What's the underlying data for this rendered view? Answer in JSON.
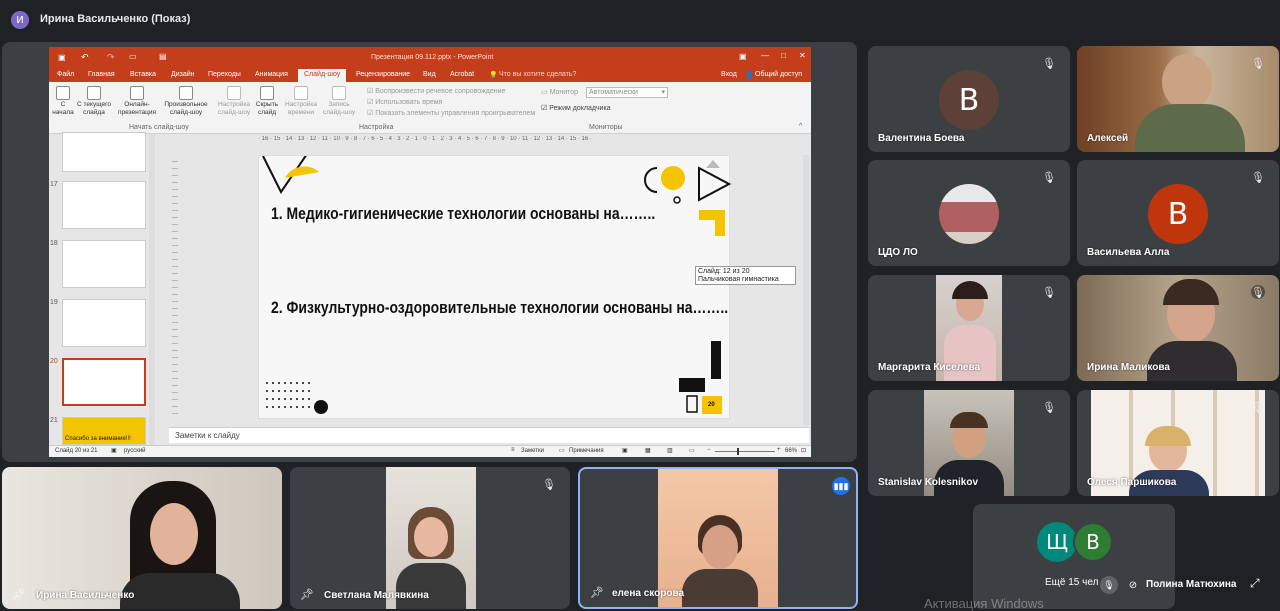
{
  "meeting": {
    "presenter_label": "Ирина Васильченко (Показ)",
    "presenter_avatar_letter": "И",
    "more_people": "Ещё 15 чел",
    "watermark": "Активация Windows"
  },
  "ppt": {
    "window_title": "Презентация 09.112.pptx - PowerPoint",
    "tabs": [
      "Файл",
      "Главная",
      "Вставка",
      "Дизайн",
      "Переходы",
      "Анимация",
      "Слайд-шоу",
      "Рецензирование",
      "Вид",
      "Acrobat"
    ],
    "tell_me": "Что вы хотите сделать?",
    "signin": "Вход",
    "share": "Общий доступ",
    "ribbon_buttons": [
      {
        "label1": "С",
        "label2": "начала"
      },
      {
        "label1": "С текущего",
        "label2": "слайда"
      },
      {
        "label1": "Онлайн-",
        "label2": "презентация"
      },
      {
        "label1": "Произвольное",
        "label2": "слайд-шоу"
      },
      {
        "label1": "Настройка",
        "label2": "слайд-шоу"
      },
      {
        "label1": "Скрыть",
        "label2": "слайд"
      },
      {
        "label1": "Настройка",
        "label2": "времени"
      },
      {
        "label1": "Запись",
        "label2": "слайд-шоу"
      }
    ],
    "group_start": "Начать слайд-шоу",
    "group_setup": "Настройка",
    "group_monitors": "Мониторы",
    "checks": [
      "Воспроизвести речевое сопровождение",
      "Использовать время",
      "Показать элементы управления проигрывателем"
    ],
    "monitor_label": "Монитор",
    "monitor_value": "Автоматически",
    "presenter_view": "Режим докладчика",
    "thumb_numbers": [
      "17",
      "18",
      "19",
      "20",
      "21"
    ],
    "thumb21_text": "Спасибо за внимание!!!",
    "slide_line1": "1.   Медико-гигиенические технологии основаны на……..",
    "slide_line2": "2.   Физкультурно-оздоровительные технологии основаны на……..",
    "slide_page": "20",
    "tooltip_line1": "Слайд: 12 из 20",
    "tooltip_line2": "Пальчиковая гимнастика",
    "notes": "Заметки к слайду",
    "status_slide": "Слайд 20 из 21",
    "status_lang": "русский",
    "status_notes": "Заметки",
    "status_comments": "Примечания",
    "zoom": "66%",
    "ruler": "· 16 · 15 · 14 · 13 · 12 · 11 · 10 · 9 · 8 · 7 · 6 · 5 · 4 · 3 · 2 · 1 · 0 · 1 · 2 · 3 · 4 · 5 · 6 · 7 · 8 · 9 · 10 · 11 · 12 · 13 · 14 · 15 · 16 ·"
  },
  "participants": [
    {
      "name": "Валентина Боева",
      "letter": "В",
      "color": "#5d4037"
    },
    {
      "name": "Алексей"
    },
    {
      "name": "ЦДО ЛО"
    },
    {
      "name": "Васильева Алла",
      "letter": "В",
      "color": "#bf360c"
    },
    {
      "name": "Маргарита Киселева"
    },
    {
      "name": "Ирина Маликова"
    },
    {
      "name": "Stanislav Kolesnikov"
    },
    {
      "name": "Олеся Паршикова"
    }
  ],
  "bottom": [
    {
      "name": "Ирина Васильченко"
    },
    {
      "name": "Светлана Малявкина"
    },
    {
      "name": "елена скорова"
    }
  ],
  "more_avatars": [
    "Щ",
    "В"
  ],
  "last_name": "Полина Матюхина",
  "colors": {
    "accent": "#c43e1c",
    "yellow": "#f5c400",
    "speaking": "#8ab4f8"
  }
}
